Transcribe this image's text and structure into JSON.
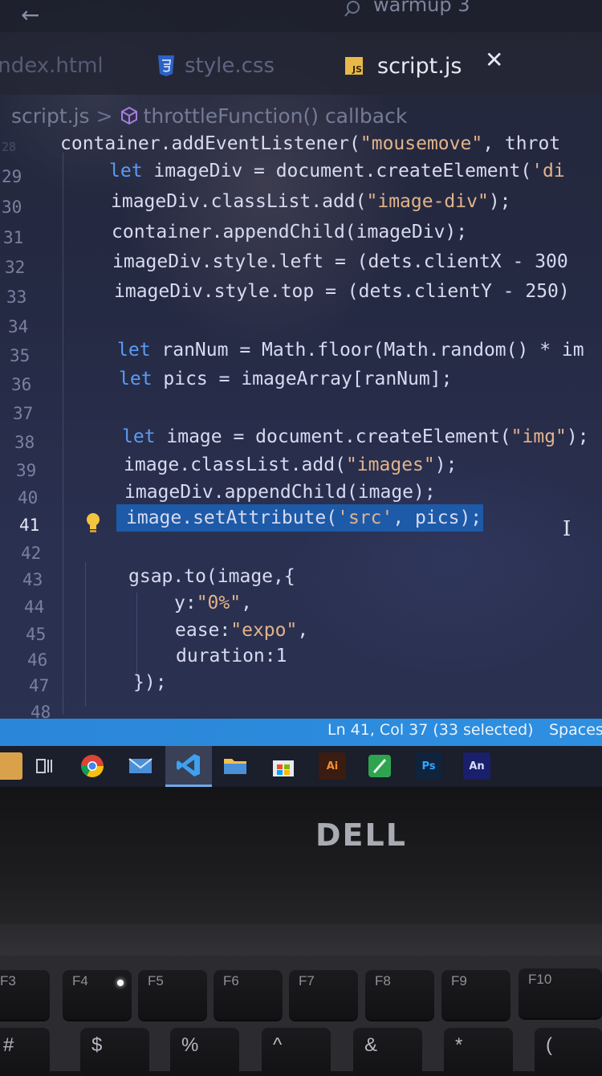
{
  "titlebar": {
    "back": "←",
    "title": "warmup 3"
  },
  "tabs": [
    {
      "label": "index.html",
      "active": false
    },
    {
      "label": "style.css",
      "active": false
    },
    {
      "label": "script.js",
      "active": true
    }
  ],
  "tab_close": "✕",
  "js_icon": "JS",
  "breadcrumb": {
    "file": "script.js",
    "separator": ">",
    "symbol": "throttleFunction() callback"
  },
  "editor": {
    "lines": [
      {
        "num": "28",
        "text": "container.addEventListener(\"mousemove\", throt"
      },
      {
        "num": "29",
        "text": "let imageDiv = document.createElement('di"
      },
      {
        "num": "30",
        "text": "imageDiv.classList.add(\"image-div\");"
      },
      {
        "num": "31",
        "text": "container.appendChild(imageDiv);"
      },
      {
        "num": "32",
        "text": "imageDiv.style.left = (dets.clientX - 300"
      },
      {
        "num": "33",
        "text": "imageDiv.style.top = (dets.clientY - 250)"
      },
      {
        "num": "34",
        "text": ""
      },
      {
        "num": "35",
        "text": "let ranNum = Math.floor(Math.random() * im"
      },
      {
        "num": "36",
        "text": "let pics = imageArray[ranNum];"
      },
      {
        "num": "37",
        "text": ""
      },
      {
        "num": "38",
        "text": "let image = document.createElement(\"img\");"
      },
      {
        "num": "39",
        "text": "image.classList.add(\"images\");"
      },
      {
        "num": "40",
        "text": "imageDiv.appendChild(image);"
      },
      {
        "num": "41",
        "text": "image.setAttribute('src', pics);"
      },
      {
        "num": "42",
        "text": ""
      },
      {
        "num": "43",
        "text": "gsap.to(image,{"
      },
      {
        "num": "44",
        "text": "y:\"0%\","
      },
      {
        "num": "45",
        "text": "ease:\"expo\","
      },
      {
        "num": "46",
        "text": "duration:1"
      },
      {
        "num": "47",
        "text": "});"
      },
      {
        "num": "48",
        "text": ""
      }
    ],
    "active_line": "41",
    "cursor": "I"
  },
  "statusbar": {
    "position": "Ln 41, Col 37 (33 selected)",
    "spaces": "Spaces"
  },
  "taskbar": {
    "apps": [
      "start",
      "task-view",
      "chrome",
      "mail",
      "vscode",
      "file-explorer",
      "store",
      "illustrator",
      "sheets",
      "photoshop",
      "animate"
    ],
    "labels": {
      "illustrator": "Ai",
      "photoshop": "Ps",
      "animate": "An"
    }
  },
  "brand": "DELL",
  "keyboard": {
    "fn_keys": [
      "F3",
      "F4",
      "F5",
      "F6",
      "F7",
      "F8",
      "F9",
      "F10"
    ],
    "number_row": [
      "#",
      "$",
      "%",
      "^",
      "&",
      "*",
      "("
    ]
  },
  "colors": {
    "keyword": "#5b9cf2",
    "string": "#e2b38a",
    "selection": "#1d5aa8",
    "statusbar": "#2e8fe0"
  }
}
